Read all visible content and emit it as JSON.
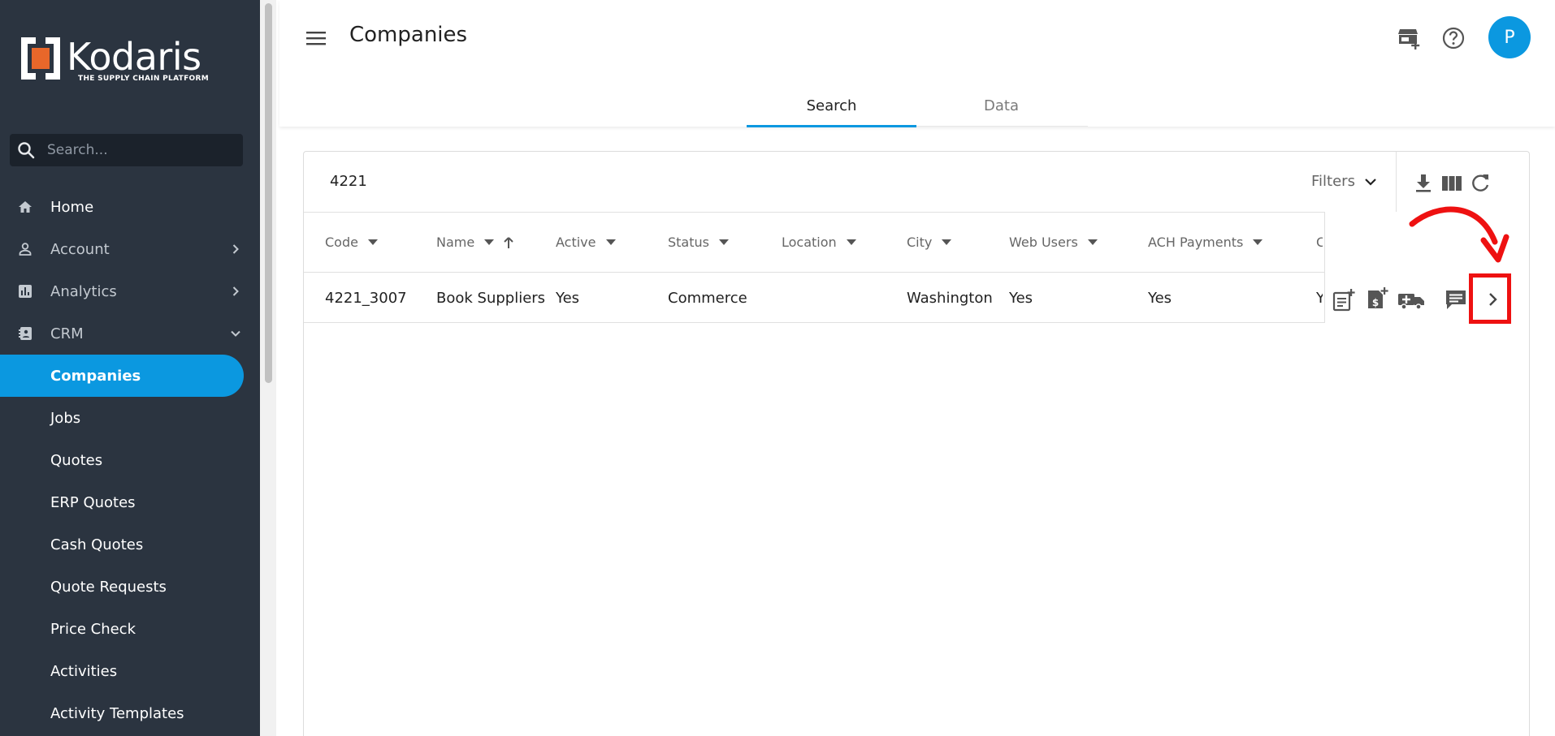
{
  "brand": {
    "name": "Kodaris",
    "tagline": "THE SUPPLY CHAIN PLATFORM"
  },
  "sidebar": {
    "search_placeholder": "Search...",
    "items": [
      {
        "label": "Home",
        "icon": "home-icon"
      },
      {
        "label": "Account",
        "icon": "person-icon"
      },
      {
        "label": "Analytics",
        "icon": "analytics-icon"
      },
      {
        "label": "CRM",
        "icon": "contact-card-icon"
      },
      {
        "label": "Companies"
      },
      {
        "label": "Jobs"
      },
      {
        "label": "Quotes"
      },
      {
        "label": "ERP Quotes"
      },
      {
        "label": "Cash Quotes"
      },
      {
        "label": "Quote Requests"
      },
      {
        "label": "Price Check"
      },
      {
        "label": "Activities"
      },
      {
        "label": "Activity Templates"
      }
    ]
  },
  "header": {
    "title": "Companies",
    "avatar_initial": "P",
    "tabs": [
      {
        "label": "Search"
      },
      {
        "label": "Data"
      }
    ]
  },
  "search": {
    "query": "4221",
    "filters_label": "Filters"
  },
  "table": {
    "columns": [
      {
        "label": "Code"
      },
      {
        "label": "Name"
      },
      {
        "label": "Active"
      },
      {
        "label": "Status"
      },
      {
        "label": "Location"
      },
      {
        "label": "City"
      },
      {
        "label": "Web Users"
      },
      {
        "label": "ACH Payments"
      },
      {
        "label": "Co"
      }
    ],
    "rows": [
      {
        "cells": [
          "4221_3007",
          "Book Suppliers",
          "Yes",
          "Commerce",
          "",
          "Washington",
          "Yes",
          "Yes",
          "Ye"
        ]
      }
    ]
  },
  "colors": {
    "accent": "#0b98e0",
    "sidebar": "#2b3440",
    "highlight": "#ee1111"
  }
}
